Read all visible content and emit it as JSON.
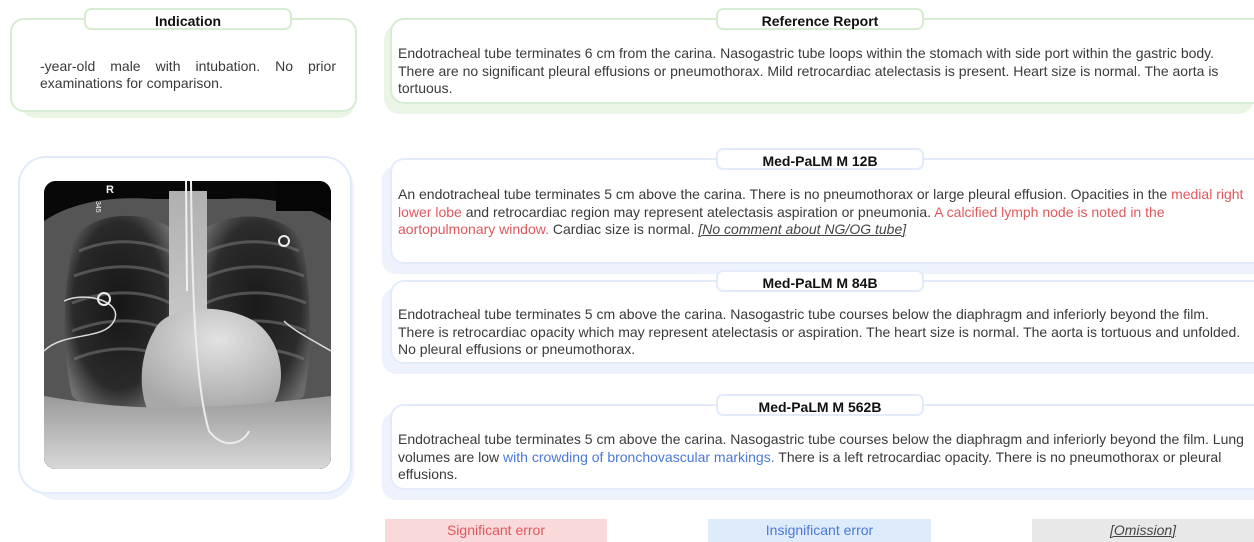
{
  "indication": {
    "title": "Indication",
    "text": "-year-old male with intubation. No prior examinations for comparison."
  },
  "reference": {
    "title": "Reference Report",
    "text": "Endotracheal tube terminates 6 cm from the carina. Nasogastric tube loops within the stomach with side port within the gastric body. There are no significant pleural effusions or pneumothorax. Mild retrocardiac atelectasis is present. Heart size is normal. The aorta is tortuous."
  },
  "xray_markers": [
    "R",
    "345"
  ],
  "models": [
    {
      "title": "Med-PaLM M 12B",
      "segments": [
        {
          "text": "An endotracheal tube terminates 5 cm above the carina. There is no pneumothorax or large pleural effusion. Opacities in the ",
          "kind": "normal"
        },
        {
          "text": "medial right lower lobe",
          "kind": "significant"
        },
        {
          "text": " and retrocardiac region may represent atelectasis aspiration or pneumonia. ",
          "kind": "normal"
        },
        {
          "text": "A calcified lymph node is noted in the aortopulmonary window.",
          "kind": "significant"
        },
        {
          "text": " Cardiac size is normal. ",
          "kind": "normal"
        },
        {
          "text": "[No comment about NG/OG tube]",
          "kind": "omission"
        }
      ]
    },
    {
      "title": "Med-PaLM M 84B",
      "segments": [
        {
          "text": "Endotracheal tube terminates 5 cm above the carina. Nasogastric tube courses below the diaphragm and inferiorly beyond the film. There is retrocardiac opacity which may represent atelectasis or aspiration. The heart size is normal. The aorta is tortuous and unfolded. No pleural effusions or pneumothorax.",
          "kind": "normal"
        }
      ]
    },
    {
      "title": "Med-PaLM M 562B",
      "segments": [
        {
          "text": "Endotracheal tube terminates 5 cm above the carina. Nasogastric tube courses below the diaphragm and inferiorly beyond the film. Lung volumes are low ",
          "kind": "normal"
        },
        {
          "text": "with crowding of bronchovascular markings.",
          "kind": "insignificant"
        },
        {
          "text": " There is a left retrocardiac opacity. There is no pneumothorax or pleural effusions.",
          "kind": "normal"
        }
      ]
    }
  ],
  "legend": {
    "significant": "Significant error",
    "insignificant": "Insignificant error",
    "omission": "[Omission]"
  },
  "colors": {
    "significant": "#e0585d",
    "insignificant": "#4a78d8",
    "indication_border": "#d7ecd1",
    "model_border": "#e3ebfb"
  }
}
